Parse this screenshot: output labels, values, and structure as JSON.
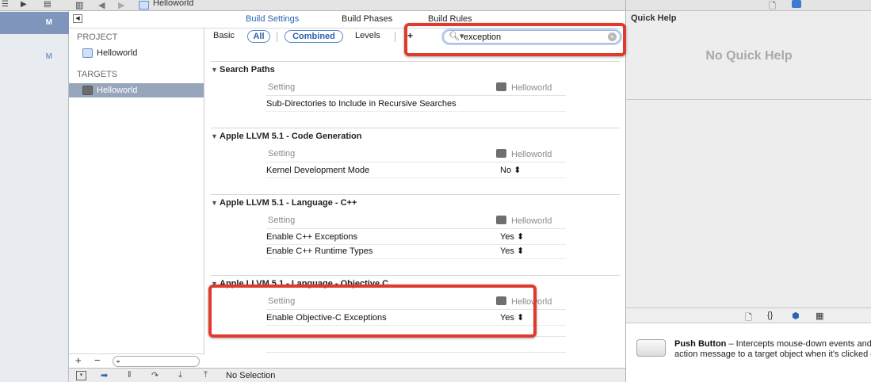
{
  "jumpbar": {
    "title": "Helloworld"
  },
  "tabs": [
    {
      "label": "Build Settings",
      "active": true
    },
    {
      "label": "Build Phases",
      "active": false
    },
    {
      "label": "Build Rules",
      "active": false
    }
  ],
  "navigator": {
    "badges": [
      "M",
      "M"
    ],
    "project_header": "PROJECT",
    "project_item": "Helloworld",
    "targets_header": "TARGETS",
    "target_item": "Helloworld",
    "add_symbol": "+",
    "remove_symbol": "−"
  },
  "filter": {
    "basic": "Basic",
    "all": "All",
    "combined": "Combined",
    "levels": "Levels",
    "add_symbol": "+",
    "search_value": "exception"
  },
  "columns": {
    "setting": "Setting",
    "target": "Helloworld"
  },
  "groups": [
    {
      "title": "Search Paths",
      "rows": [
        {
          "name": "Sub-Directories to Include in Recursive Searches",
          "value": ""
        }
      ]
    },
    {
      "title": "Apple LLVM 5.1 - Code Generation",
      "rows": [
        {
          "name": "Kernel Development Mode",
          "value": "No ⬍"
        }
      ]
    },
    {
      "title": "Apple LLVM 5.1 - Language - C++",
      "rows": [
        {
          "name": "Enable C++ Exceptions",
          "value": "Yes ⬍"
        },
        {
          "name": "Enable C++ Runtime Types",
          "value": "Yes ⬍"
        }
      ]
    },
    {
      "title": "Apple LLVM 5.1 - Language - Objective C",
      "rows": [
        {
          "name": "Enable Objective-C Exceptions",
          "value": "Yes ⬍"
        }
      ]
    }
  ],
  "debugbar": {
    "status": "No Selection"
  },
  "inspector": {
    "quick_help_title": "Quick Help",
    "quick_help_empty": "No Quick Help",
    "library_item_name": "Push Button",
    "library_item_desc_line1": " – Intercepts mouse-down events and",
    "library_item_desc_line2": "action message to a target object when it's clicked o"
  },
  "colors": {
    "accent": "#2a62b4",
    "selection": "#98a6bc",
    "annotation": "#e03a2d"
  }
}
